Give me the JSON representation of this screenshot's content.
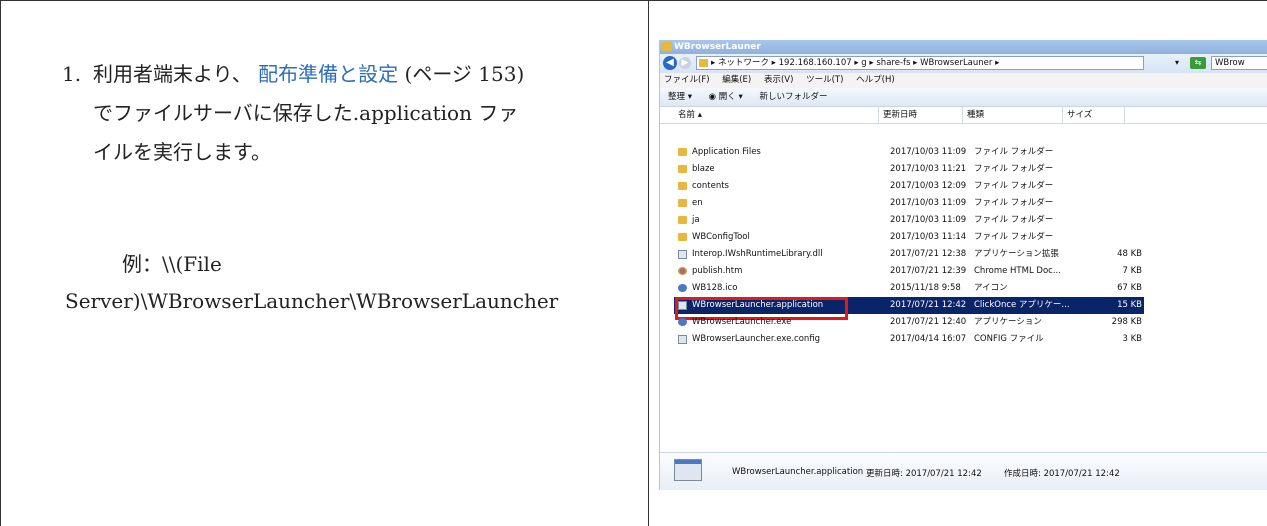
{
  "instruction": {
    "step_number": "1.",
    "line1_before": "利用者端末より、",
    "link_text": "配布準備と設定",
    "line1_after": " (ページ 153)",
    "line2": "でファイルサーバに保存した.application ファ",
    "line3": "イルを実行します。",
    "example_label": "例：\\\\(File",
    "example_path": "Server)\\WBrowserLauncher\\WBrowserLauncher"
  },
  "explorer": {
    "window_title": "WBrowserLauner",
    "back_glyph": "◀",
    "forward_glyph": "▶",
    "address": "▸ ネットワーク ▸ 192.168.160.107 ▸ g ▸ share-fs ▸ WBrowserLauner ▸",
    "dropdown_glyph": "▾",
    "go_glyph": "⇆",
    "search_placeholder": "WBrow",
    "menu": [
      "ファイル(F)",
      "編集(E)",
      "表示(V)",
      "ツール(T)",
      "ヘルプ(H)"
    ],
    "toolbar": [
      "整理 ▾",
      "◉ 開く ▾",
      "新しいフォルダー"
    ],
    "columns": {
      "name": "名前 ▴",
      "date": "更新日時",
      "type": "種類",
      "size": "サイズ"
    },
    "files": [
      {
        "name": "Application Files",
        "date": "2017/10/03 11:09",
        "type": "ファイル フォルダー",
        "size": "",
        "icon": "folder"
      },
      {
        "name": "blaze",
        "date": "2017/10/03 11:21",
        "type": "ファイル フォルダー",
        "size": "",
        "icon": "folder"
      },
      {
        "name": "contents",
        "date": "2017/10/03 12:09",
        "type": "ファイル フォルダー",
        "size": "",
        "icon": "folder"
      },
      {
        "name": "en",
        "date": "2017/10/03 11:09",
        "type": "ファイル フォルダー",
        "size": "",
        "icon": "folder"
      },
      {
        "name": "ja",
        "date": "2017/10/03 11:09",
        "type": "ファイル フォルダー",
        "size": "",
        "icon": "folder"
      },
      {
        "name": "WBConfigTool",
        "date": "2017/10/03 11:14",
        "type": "ファイル フォルダー",
        "size": "",
        "icon": "folder"
      },
      {
        "name": "Interop.IWshRuntimeLibrary.dll",
        "date": "2017/07/21 12:38",
        "type": "アプリケーション拡張",
        "size": "48 KB",
        "icon": "file"
      },
      {
        "name": "publish.htm",
        "date": "2017/07/21 12:39",
        "type": "Chrome HTML Doc...",
        "size": "7 KB",
        "icon": "chrome"
      },
      {
        "name": "WB128.ico",
        "date": "2015/11/18 9:58",
        "type": "アイコン",
        "size": "67 KB",
        "icon": "gear"
      },
      {
        "name": "WBrowserLauncher.application",
        "date": "2017/07/21 12:42",
        "type": "ClickOnce アプリケー...",
        "size": "15 KB",
        "icon": "file",
        "selected": true
      },
      {
        "name": "WBrowserLauncher.exe",
        "date": "2017/07/21 12:40",
        "type": "アプリケーション",
        "size": "298 KB",
        "icon": "gear"
      },
      {
        "name": "WBrowserLauncher.exe.config",
        "date": "2017/04/14 16:07",
        "type": "CONFIG ファイル",
        "size": "3 KB",
        "icon": "file"
      }
    ],
    "status": {
      "name": "WBrowserLauncher.application",
      "modified": "更新日時: 2017/07/21 12:42",
      "created": "作成日時: 2017/07/21 12:42"
    }
  }
}
